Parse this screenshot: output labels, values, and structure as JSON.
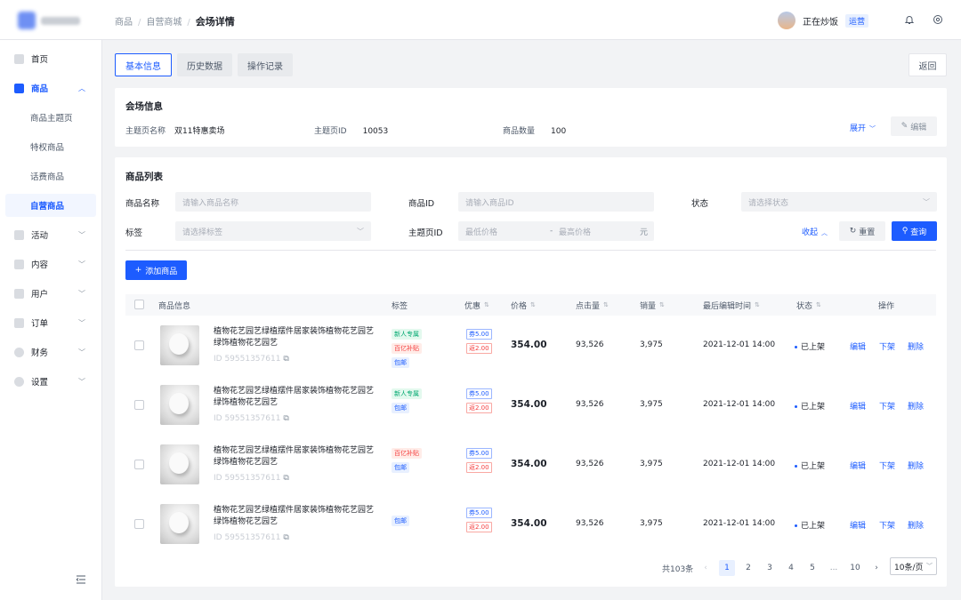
{
  "header": {
    "breadcrumb": [
      "商品",
      "自营商城",
      "会场详情"
    ],
    "user": {
      "name": "正在炒饭",
      "role": "运营"
    }
  },
  "sidebar": {
    "items": [
      {
        "label": "首页"
      },
      {
        "label": "商品",
        "expanded": true
      },
      {
        "label": "商品主题页"
      },
      {
        "label": "特权商品"
      },
      {
        "label": "话费商品"
      },
      {
        "label": "自营商品",
        "active": true
      },
      {
        "label": "活动"
      },
      {
        "label": "内容"
      },
      {
        "label": "用户"
      },
      {
        "label": "订单"
      },
      {
        "label": "财务"
      },
      {
        "label": "设置"
      }
    ]
  },
  "tabs": [
    {
      "label": "基本信息",
      "active": true
    },
    {
      "label": "历史数据"
    },
    {
      "label": "操作记录"
    }
  ],
  "back_label": "返回",
  "venue": {
    "title": "会场信息",
    "fields": [
      {
        "key": "主题页名称",
        "value": "双11特惠卖场"
      },
      {
        "key": "主题页ID",
        "value": "10053"
      },
      {
        "key": "商品数量",
        "value": "100"
      }
    ],
    "expand_label": "展开",
    "edit_label": "编辑"
  },
  "list": {
    "title": "商品列表",
    "filters": {
      "name_label": "商品名称",
      "name_placeholder": "请输入商品名称",
      "id_label": "商品ID",
      "id_placeholder": "请输入商品ID",
      "status_label": "状态",
      "status_placeholder": "请选择状态",
      "tag_label": "标签",
      "tag_placeholder": "请选择标签",
      "page_id_label": "主题页ID",
      "min_price": "最低价格",
      "max_price": "最高价格",
      "price_sep": "-",
      "unit": "元"
    },
    "collapse_label": "收起",
    "reset_label": "重置",
    "search_label": "查询",
    "add_label": "添加商品",
    "columns": [
      "商品信息",
      "标签",
      "优惠",
      "价格",
      "点击量",
      "销量",
      "最后编辑时间",
      "状态",
      "操作"
    ],
    "rows": [
      {
        "name": "植物花艺园艺绿植摆件居家装饰植物花艺园艺绿饰植物花艺园艺",
        "id": "ID 59551357611",
        "tags": [
          {
            "text": "新人专属",
            "color": "green"
          },
          {
            "text": "百亿补贴",
            "color": "red"
          },
          {
            "text": "包邮",
            "color": "blue"
          }
        ],
        "coupons": [
          "券5.00",
          "返2.00"
        ],
        "price": "354.00",
        "clicks": "93,526",
        "sales": "3,975",
        "time": "2021-12-01 14:00",
        "status": "已上架"
      },
      {
        "name": "植物花艺园艺绿植摆件居家装饰植物花艺园艺绿饰植物花艺园艺",
        "id": "ID 59551357611",
        "tags": [
          {
            "text": "新人专属",
            "color": "green"
          },
          {
            "text": "包邮",
            "color": "blue"
          }
        ],
        "coupons": [
          "券5.00",
          "返2.00"
        ],
        "price": "354.00",
        "clicks": "93,526",
        "sales": "3,975",
        "time": "2021-12-01 14:00",
        "status": "已上架"
      },
      {
        "name": "植物花艺园艺绿植摆件居家装饰植物花艺园艺绿饰植物花艺园艺",
        "id": "ID 59551357611",
        "tags": [
          {
            "text": "百亿补贴",
            "color": "red"
          },
          {
            "text": "包邮",
            "color": "blue"
          }
        ],
        "coupons": [
          "券5.00",
          "返2.00"
        ],
        "price": "354.00",
        "clicks": "93,526",
        "sales": "3,975",
        "time": "2021-12-01 14:00",
        "status": "已上架"
      },
      {
        "name": "植物花艺园艺绿植摆件居家装饰植物花艺园艺绿饰植物花艺园艺",
        "id": "ID 59551357611",
        "tags": [
          {
            "text": "包邮",
            "color": "blue"
          }
        ],
        "coupons": [
          "券5.00",
          "返2.00"
        ],
        "price": "354.00",
        "clicks": "93,526",
        "sales": "3,975",
        "time": "2021-12-01 14:00",
        "status": "已上架"
      }
    ],
    "ops": [
      "编辑",
      "下架",
      "删除"
    ]
  },
  "pagination": {
    "total": "共103条",
    "pages": [
      "1",
      "2",
      "3",
      "4",
      "5",
      "...",
      "10"
    ],
    "current": "1",
    "page_size": "10条/页"
  }
}
